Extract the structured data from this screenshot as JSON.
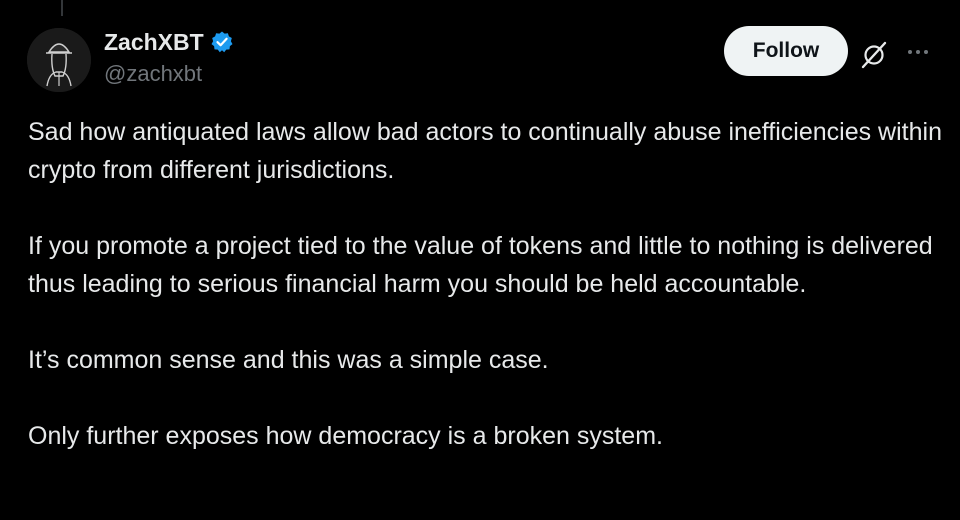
{
  "author": {
    "display_name": "ZachXBT",
    "handle": "@zachxbt",
    "verified": true,
    "avatar_icon": "detective-avatar-icon"
  },
  "actions": {
    "follow_label": "Follow",
    "grok_icon": "grok-icon",
    "more_icon": "more-options-icon"
  },
  "tweet": {
    "paragraphs": [
      "Sad how antiquated laws allow bad actors to continually abuse inefficiencies within crypto from different jurisdictions.",
      "If you promote a project tied to the value of tokens and little to nothing is delivered thus leading to serious financial harm you should be held accountable.",
      "It’s common sense and this was a simple case.",
      "Only further exposes how democracy is a broken system."
    ]
  },
  "colors": {
    "background": "#000000",
    "text_primary": "#e7e9ea",
    "text_secondary": "#71767b",
    "verified_badge": "#1d9bf0",
    "follow_bg": "#eff3f4"
  }
}
